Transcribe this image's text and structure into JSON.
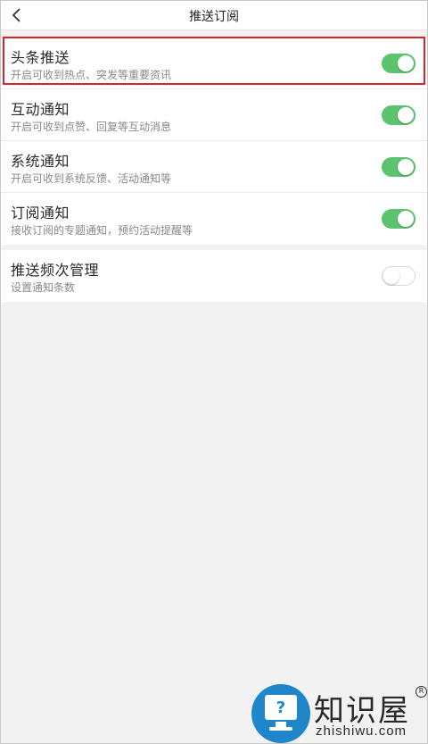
{
  "header": {
    "title": "推送订阅",
    "back_icon": "chevron-left-icon"
  },
  "settings_group_1": [
    {
      "title": "头条推送",
      "subtitle": "开启可收到热点、突发等重要资讯",
      "enabled": true
    },
    {
      "title": "互动通知",
      "subtitle": "开启可收到点赞、回复等互动消息",
      "enabled": true
    },
    {
      "title": "系统通知",
      "subtitle": "开启可收到系统反馈、活动通知等",
      "enabled": true
    },
    {
      "title": "订阅通知",
      "subtitle": "接收订阅的专题通知，预约活动提醒等",
      "enabled": true
    }
  ],
  "settings_group_2": [
    {
      "title": "推送频次管理",
      "subtitle": "设置通知条数",
      "enabled": false
    }
  ],
  "colors": {
    "toggle_on": "#5cc46e",
    "highlight_border": "#d9232d",
    "watermark_blue": "#1f86c9"
  },
  "watermark": {
    "brand": "知识屋",
    "registered": "R",
    "domain": "zhishiwu.com",
    "monitor_glyph": "?"
  }
}
